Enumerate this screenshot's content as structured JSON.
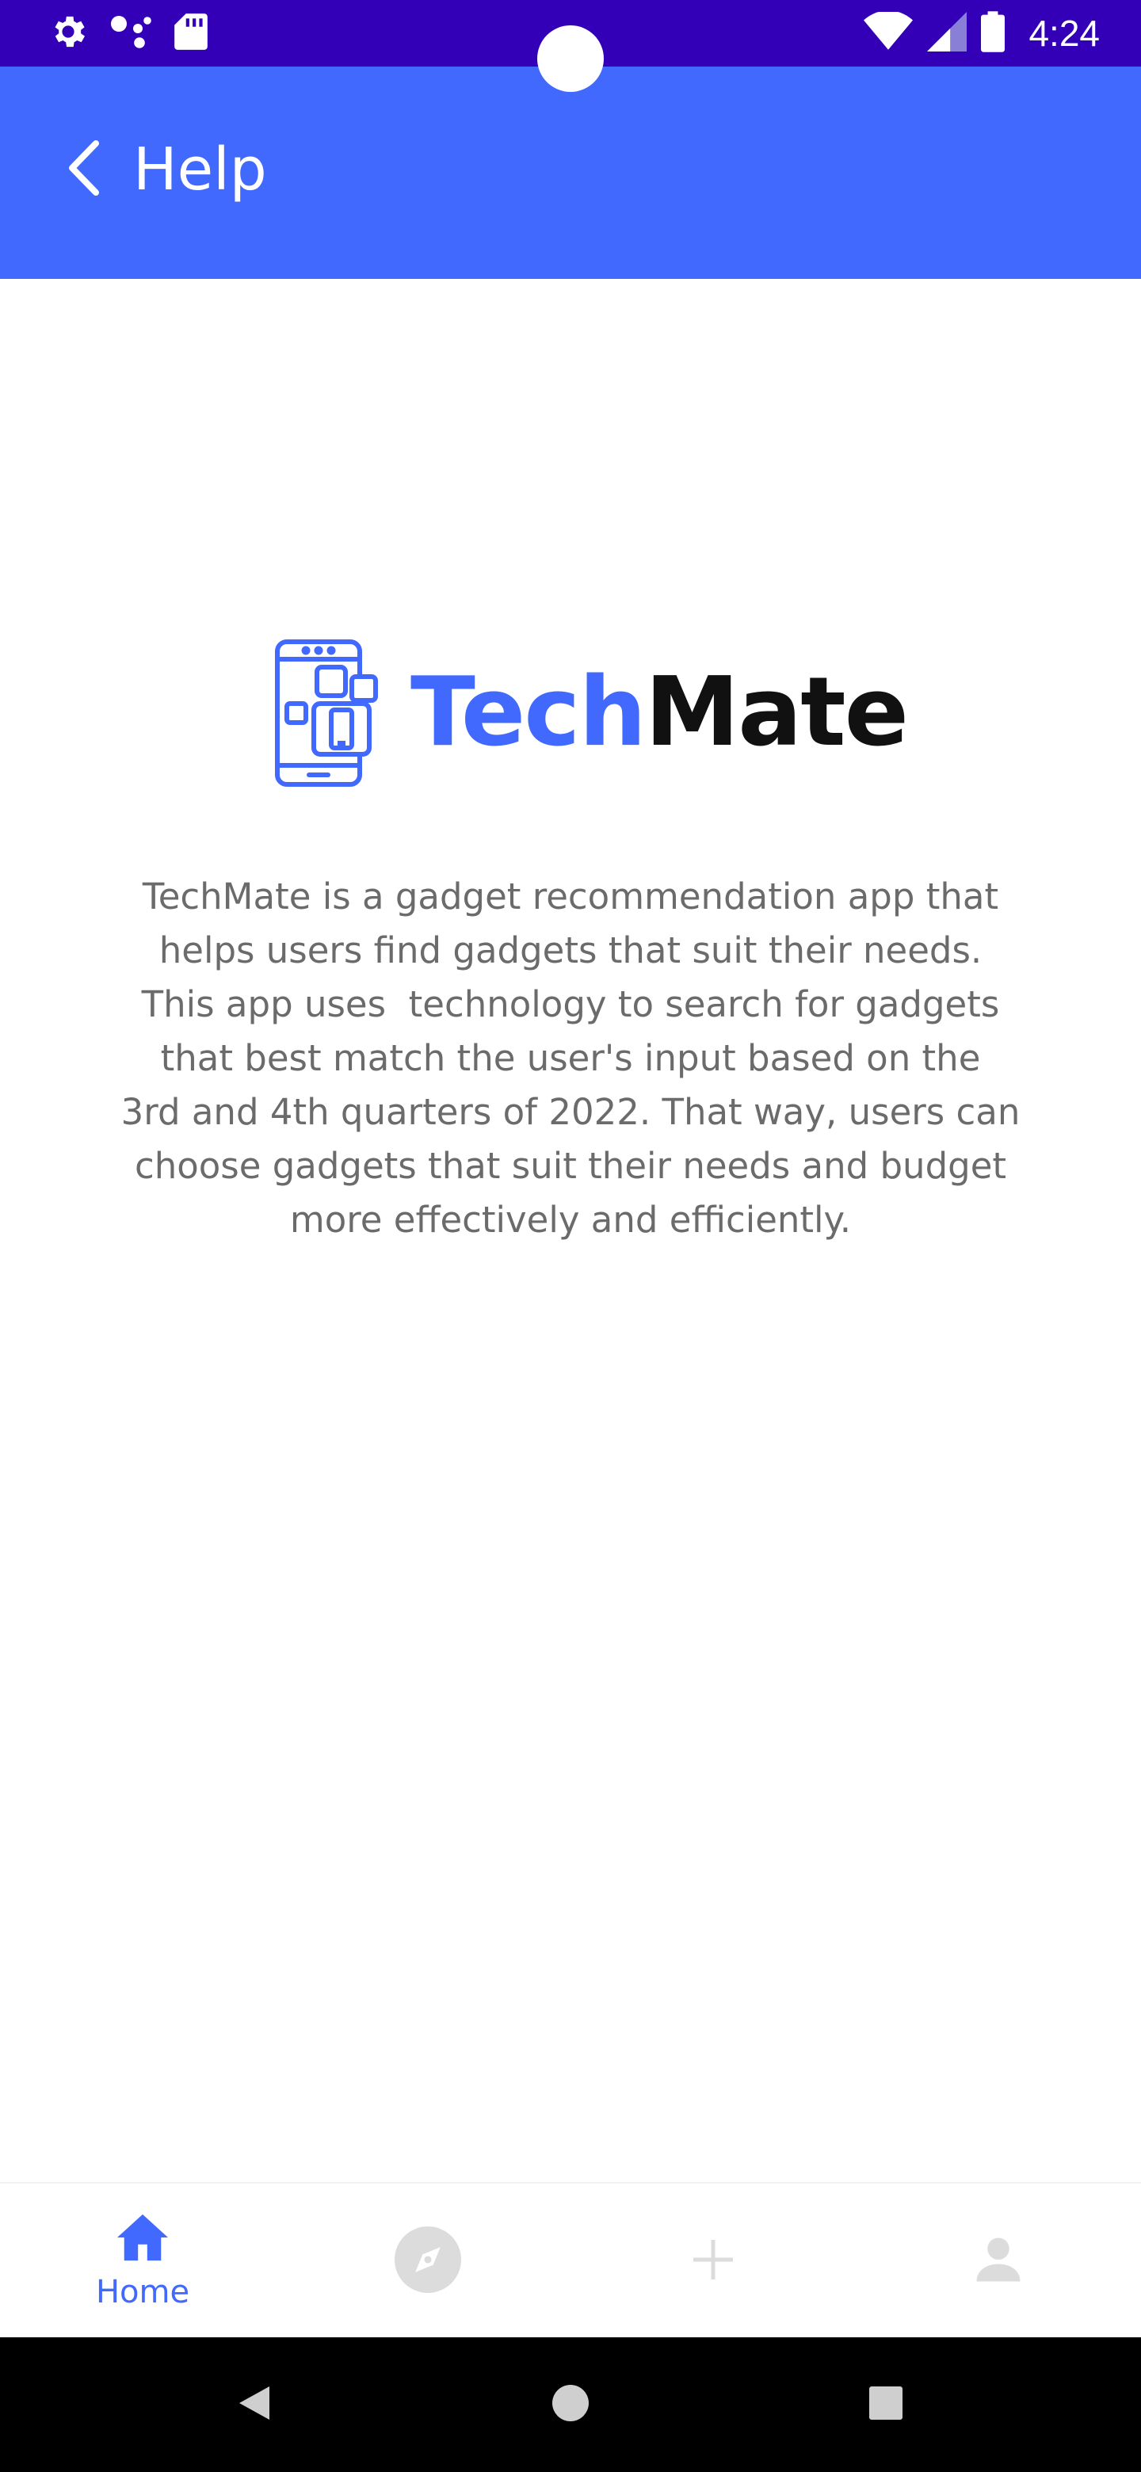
{
  "status_bar": {
    "time": "4:24",
    "left_icons": [
      "settings-icon",
      "assistant-dots-icon",
      "sd-card-icon"
    ],
    "right_icons": [
      "wifi-icon",
      "signal-icon",
      "battery-icon"
    ]
  },
  "app_bar": {
    "title": "Help",
    "back_icon": "chevron-left-icon",
    "color": "#4169fe"
  },
  "logo": {
    "text_part1": "Tech",
    "text_part2": "Mate",
    "icon": "phone-apps-icon",
    "accent_color": "#4169fe"
  },
  "description": {
    "lines": [
      "TechMate is a gadget recommendation app that",
      "helps users find gadgets that suit their needs.",
      "This app uses  technology to search for gadgets",
      "that best match the user's input based on the",
      "3rd and 4th quarters of 2022. That way, users can",
      "choose gadgets that suit their needs and budget",
      "more effectively and efficiently."
    ]
  },
  "bottom_nav": {
    "items": [
      {
        "label": "Home",
        "icon": "home-icon",
        "active": true
      },
      {
        "label": "",
        "icon": "compass-icon",
        "active": false
      },
      {
        "label": "",
        "icon": "plus-icon",
        "active": false
      },
      {
        "label": "",
        "icon": "person-icon",
        "active": false
      }
    ],
    "active_color": "#4169fe",
    "inactive_color": "#dcdcdc"
  },
  "system_nav": {
    "buttons": [
      "back-triangle-icon",
      "home-circle-icon",
      "recents-square-icon"
    ]
  }
}
